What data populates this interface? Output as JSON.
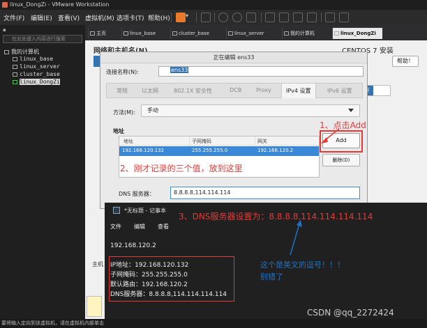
{
  "window": {
    "title": "linux_DongZi - VMware Workstation"
  },
  "menubar": {
    "items": [
      "文件(F)",
      "编辑(E)",
      "查看(V)",
      "虚拟机(M)",
      "选项卡(T)",
      "帮助(H)"
    ]
  },
  "sidebar": {
    "search_placeholder": "在此处键入内容进行搜索",
    "root": "我的计算机",
    "items": [
      "linux_base",
      "linux_server",
      "cluster_base",
      "linux_DongZi"
    ]
  },
  "tabs": [
    "主页",
    "linux_base",
    "cluster_base",
    "linux_server",
    "我的计算机",
    "linux_DongZi"
  ],
  "guest": {
    "header": "网络和主机名(N)",
    "os_label": "CENTOS 7 安装",
    "help_label": "帮助！",
    "toggle_on": "打开"
  },
  "dialog": {
    "title": "正在编辑 ens33",
    "conn_name_label": "连接名称(N):",
    "conn_name_value": "ens33",
    "tabs": [
      "常规",
      "以太网",
      "802.1X 安全性",
      "DCB",
      "Proxy",
      "IPv4 设置",
      "IPv6 设置"
    ],
    "method_label": "方法(M):",
    "method_value": "手动",
    "address_section": "地址",
    "table_headers": [
      "地址",
      "子网掩码",
      "网关"
    ],
    "table_row": [
      "192.168.120.132",
      "255.255.255.0",
      "192.168.120.2"
    ],
    "add_label": "Add",
    "delete_label": "删除(D)",
    "dns_label": "DNS 服务器：",
    "dns_value": "8.8.8.8,114.114.114"
  },
  "notepad": {
    "title": "*无标题 - 记事本",
    "menu": [
      "文件",
      "编辑",
      "查看"
    ],
    "line1": "192.168.120.2",
    "lines": [
      "IP地址：192.168.120.132",
      "子网掩码：255.255.255.0",
      "默认路由：192.168.120.2",
      "DNS服务器：8.8.8.8,114.114.114.114"
    ]
  },
  "annotations": {
    "step1": "1、点击Add",
    "step2": "2、刚才记录的三个值，放到这里",
    "step3": "3、DNS服务器设置为：8.8.8.8,114.114.114.114",
    "note_line1": "这个是英文的逗号！！！",
    "note_line2": "别错了"
  },
  "left_fragment": "主机",
  "statusbar": "要将输入定向到该虚拟机，请在虚拟机内部单击",
  "watermark": "CSDN @qq_2272424",
  "colors": {
    "accent_red": "#e53935",
    "accent_blue": "#1e73c8",
    "selection": "#3a88d6",
    "pause": "#e87a2b"
  }
}
